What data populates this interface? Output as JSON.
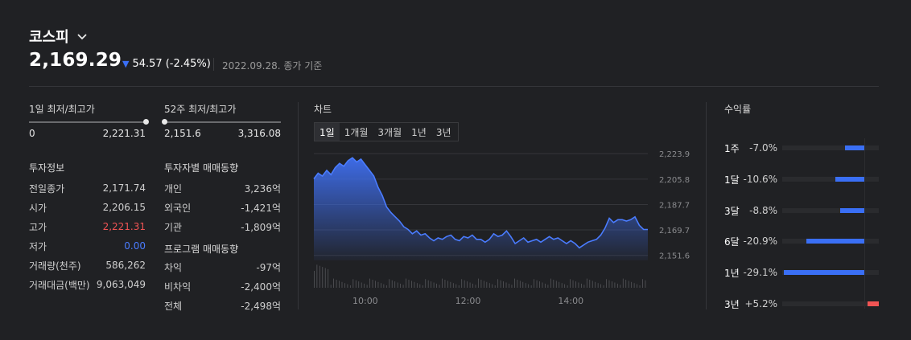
{
  "header": {
    "index_name": "코스피",
    "price": "2,169.29",
    "change": "54.57",
    "change_pct": "(-2.45%)",
    "as_of": "2022.09.28. 종가 기준"
  },
  "ranges": [
    {
      "label": "1일 최저/최고가",
      "low": "0",
      "high": "2,221.31",
      "position": 1.0
    },
    {
      "label": "52주 최저/최고가",
      "low": "2,151.6",
      "high": "3,316.08",
      "position": 0.0
    }
  ],
  "investment_info": {
    "title": "투자정보",
    "rows": [
      {
        "label": "전일종가",
        "value": "2,171.74",
        "color": "default"
      },
      {
        "label": "시가",
        "value": "2,206.15",
        "color": "default"
      },
      {
        "label": "고가",
        "value": "2,221.31",
        "color": "red"
      },
      {
        "label": "저가",
        "value": "0.00",
        "color": "blue"
      },
      {
        "label": "거래량(천주)",
        "value": "586,262",
        "color": "default"
      },
      {
        "label": "거래대금(백만)",
        "value": "9,063,049",
        "color": "default"
      }
    ]
  },
  "investor_trend": {
    "title": "투자자별 매매동향",
    "rows": [
      {
        "label": "개인",
        "value": "3,236억"
      },
      {
        "label": "외국인",
        "value": "-1,421억"
      },
      {
        "label": "기관",
        "value": "-1,809억"
      }
    ]
  },
  "program_trend": {
    "title": "프로그램 매매동향",
    "rows": [
      {
        "label": "차익",
        "value": "-97억"
      },
      {
        "label": "비차익",
        "value": "-2,400억"
      },
      {
        "label": "전체",
        "value": "-2,498억"
      }
    ]
  },
  "chart": {
    "title": "차트",
    "tabs": [
      "1일",
      "1개월",
      "3개월",
      "1년",
      "3년"
    ],
    "active_tab": "1일"
  },
  "returns": {
    "title": "수익률",
    "rows": [
      {
        "period": "1주",
        "value": "-7.0%",
        "pct": -7.0
      },
      {
        "period": "1달",
        "value": "-10.6%",
        "pct": -10.6
      },
      {
        "period": "3달",
        "value": "-8.8%",
        "pct": -8.8
      },
      {
        "period": "6달",
        "value": "-20.9%",
        "pct": -20.9
      },
      {
        "period": "1년",
        "value": "-29.1%",
        "pct": -29.1
      },
      {
        "period": "3년",
        "value": "+5.2%",
        "pct": 5.2
      }
    ]
  },
  "colors": {
    "up": "#f05454",
    "down": "#3a6ff5",
    "background": "#202124"
  },
  "chart_data": {
    "type": "area",
    "yticks": [
      "2,223.9",
      "2,205.8",
      "2,187.7",
      "2,169.7",
      "2,151.6"
    ],
    "ytick_values": [
      2223.9,
      2205.8,
      2187.7,
      2169.7,
      2151.6
    ],
    "xticks": [
      "10:00",
      "12:00",
      "14:00"
    ],
    "xtick_minutes": [
      60,
      180,
      300
    ],
    "ylim": [
      2148,
      2228
    ],
    "xlim": [
      0,
      390
    ],
    "x": [
      0,
      5,
      10,
      15,
      20,
      25,
      30,
      35,
      40,
      45,
      50,
      55,
      60,
      65,
      70,
      75,
      80,
      85,
      90,
      95,
      100,
      105,
      110,
      115,
      120,
      125,
      130,
      135,
      140,
      145,
      150,
      155,
      160,
      165,
      170,
      175,
      180,
      185,
      190,
      195,
      200,
      205,
      210,
      215,
      220,
      225,
      230,
      235,
      240,
      245,
      250,
      255,
      260,
      265,
      270,
      275,
      280,
      285,
      290,
      295,
      300,
      305,
      310,
      315,
      320,
      325,
      330,
      335,
      340,
      345,
      350,
      355,
      360,
      365,
      370,
      375,
      380,
      385,
      390
    ],
    "y": [
      2206,
      2210,
      2208,
      2212,
      2209,
      2214,
      2217,
      2215,
      2219,
      2221,
      2218,
      2220,
      2216,
      2212,
      2208,
      2200,
      2194,
      2186,
      2182,
      2179,
      2176,
      2172,
      2170,
      2167,
      2169,
      2166,
      2167,
      2164,
      2162,
      2164,
      2163,
      2165,
      2166,
      2163,
      2162,
      2165,
      2164,
      2166,
      2163,
      2163,
      2161,
      2163,
      2167,
      2165,
      2166,
      2169,
      2165,
      2160,
      2162,
      2164,
      2161,
      2162,
      2163,
      2161,
      2163,
      2165,
      2163,
      2164,
      2162,
      2160,
      2162,
      2160,
      2157,
      2159,
      2161,
      2162,
      2163,
      2166,
      2171,
      2178,
      2175,
      2177,
      2177,
      2176,
      2177,
      2179,
      2173,
      2170,
      2170
    ]
  }
}
